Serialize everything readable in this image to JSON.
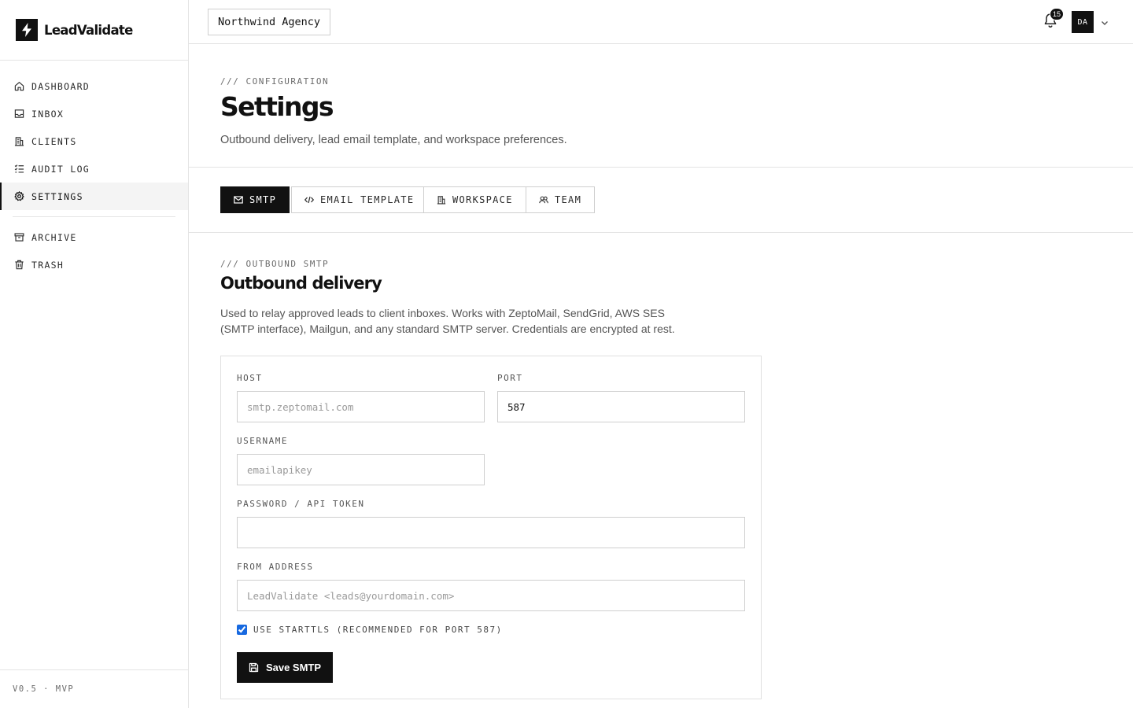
{
  "app": {
    "name": "LeadValidate",
    "version": "V0.5 · MVP"
  },
  "sidebar": {
    "items": [
      {
        "label": "DASHBOARD",
        "icon": "home-icon"
      },
      {
        "label": "INBOX",
        "icon": "inbox-icon"
      },
      {
        "label": "CLIENTS",
        "icon": "building-icon"
      },
      {
        "label": "AUDIT LOG",
        "icon": "list-checks-icon"
      },
      {
        "label": "SETTINGS",
        "icon": "gear-icon",
        "active": true
      }
    ],
    "secondary": [
      {
        "label": "ARCHIVE",
        "icon": "archive-icon"
      },
      {
        "label": "TRASH",
        "icon": "trash-icon"
      }
    ]
  },
  "topbar": {
    "workspace": "Northwind Agency",
    "notifications_count": "15",
    "avatar_initials": "DA"
  },
  "header": {
    "eyebrow": "/// CONFIGURATION",
    "title": "Settings",
    "description": "Outbound delivery, lead email template, and workspace preferences."
  },
  "tabs": [
    {
      "label": "SMTP",
      "icon": "mail-icon",
      "active": true
    },
    {
      "label": "EMAIL TEMPLATE",
      "icon": "code-icon"
    },
    {
      "label": "WORKSPACE",
      "icon": "building-icon"
    },
    {
      "label": "TEAM",
      "icon": "users-icon"
    }
  ],
  "smtp": {
    "eyebrow": "/// OUTBOUND SMTP",
    "title": "Outbound delivery",
    "description": "Used to relay approved leads to client inboxes. Works with ZeptoMail, SendGrid, AWS SES (SMTP interface), Mailgun, and any standard SMTP server. Credentials are encrypted at rest.",
    "fields": {
      "host": {
        "label": "HOST",
        "value": "",
        "placeholder": "smtp.zeptomail.com"
      },
      "port": {
        "label": "PORT",
        "value": "587",
        "placeholder": ""
      },
      "username": {
        "label": "USERNAME",
        "value": "",
        "placeholder": "emailapikey"
      },
      "password": {
        "label": "PASSWORD / API TOKEN",
        "value": "",
        "placeholder": ""
      },
      "from": {
        "label": "FROM ADDRESS",
        "value": "",
        "placeholder": "LeadValidate <leads@yourdomain.com>"
      }
    },
    "starttls": {
      "label": "USE STARTTLS (RECOMMENDED FOR PORT 587)",
      "checked": true
    },
    "save_label": "Save SMTP"
  },
  "colors": {
    "primary": "#111111",
    "border": "#e4e4e4",
    "muted": "#6b6b6b",
    "checkbox": "#1769e0"
  }
}
